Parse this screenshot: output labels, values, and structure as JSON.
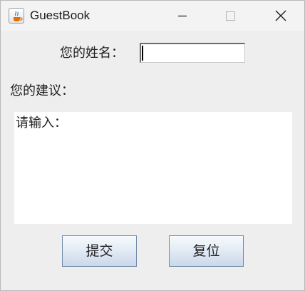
{
  "window": {
    "title": "GuestBook",
    "icons": {
      "app": "java-cup-icon",
      "minimize": "minimize-icon",
      "maximize": "maximize-icon",
      "close": "close-icon"
    }
  },
  "form": {
    "name_label": "您的姓名：",
    "name_value": "",
    "suggestion_label": "您的建议：",
    "suggestion_value": "请输入："
  },
  "buttons": {
    "submit_label": "提交",
    "reset_label": "复位"
  },
  "colors": {
    "window_bg": "#eeeeee",
    "titlebar_bg": "#f3f3f3",
    "field_bg": "#ffffff",
    "button_border": "#6f88a8"
  }
}
